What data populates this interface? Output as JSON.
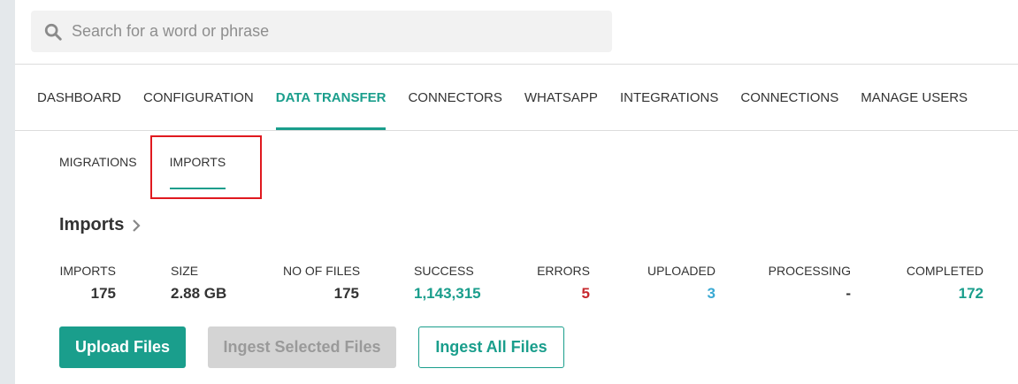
{
  "search": {
    "placeholder": "Search for a word or phrase"
  },
  "main_nav": [
    {
      "label": "DASHBOARD"
    },
    {
      "label": "CONFIGURATION"
    },
    {
      "label": "DATA TRANSFER",
      "active": true
    },
    {
      "label": "CONNECTORS"
    },
    {
      "label": "WHATSAPP"
    },
    {
      "label": "INTEGRATIONS"
    },
    {
      "label": "CONNECTIONS"
    },
    {
      "label": "MANAGE USERS"
    }
  ],
  "sub_nav": [
    {
      "label": "MIGRATIONS"
    },
    {
      "label": "IMPORTS",
      "active": true
    }
  ],
  "section": {
    "title": "Imports"
  },
  "stats": [
    {
      "label": "IMPORTS",
      "value": "175"
    },
    {
      "label": "SIZE",
      "value": "2.88 GB"
    },
    {
      "label": "NO OF FILES",
      "value": "175"
    },
    {
      "label": "SUCCESS",
      "value": "1,143,315",
      "color": "#1a9e8c"
    },
    {
      "label": "ERRORS",
      "value": "5",
      "color": "#c7282e"
    },
    {
      "label": "UPLOADED",
      "value": "3",
      "color": "#3aa9d3"
    },
    {
      "label": "PROCESSING",
      "value": "-"
    },
    {
      "label": "COMPLETED",
      "value": "172",
      "color": "#1a9e8c"
    }
  ],
  "buttons": {
    "upload": "Upload Files",
    "ingest_selected": "Ingest Selected Files",
    "ingest_all": "Ingest All Files"
  },
  "colors": {
    "accent": "#1a9e8c",
    "highlight": "#e0191f",
    "error": "#c7282e",
    "info": "#3aa9d3"
  }
}
